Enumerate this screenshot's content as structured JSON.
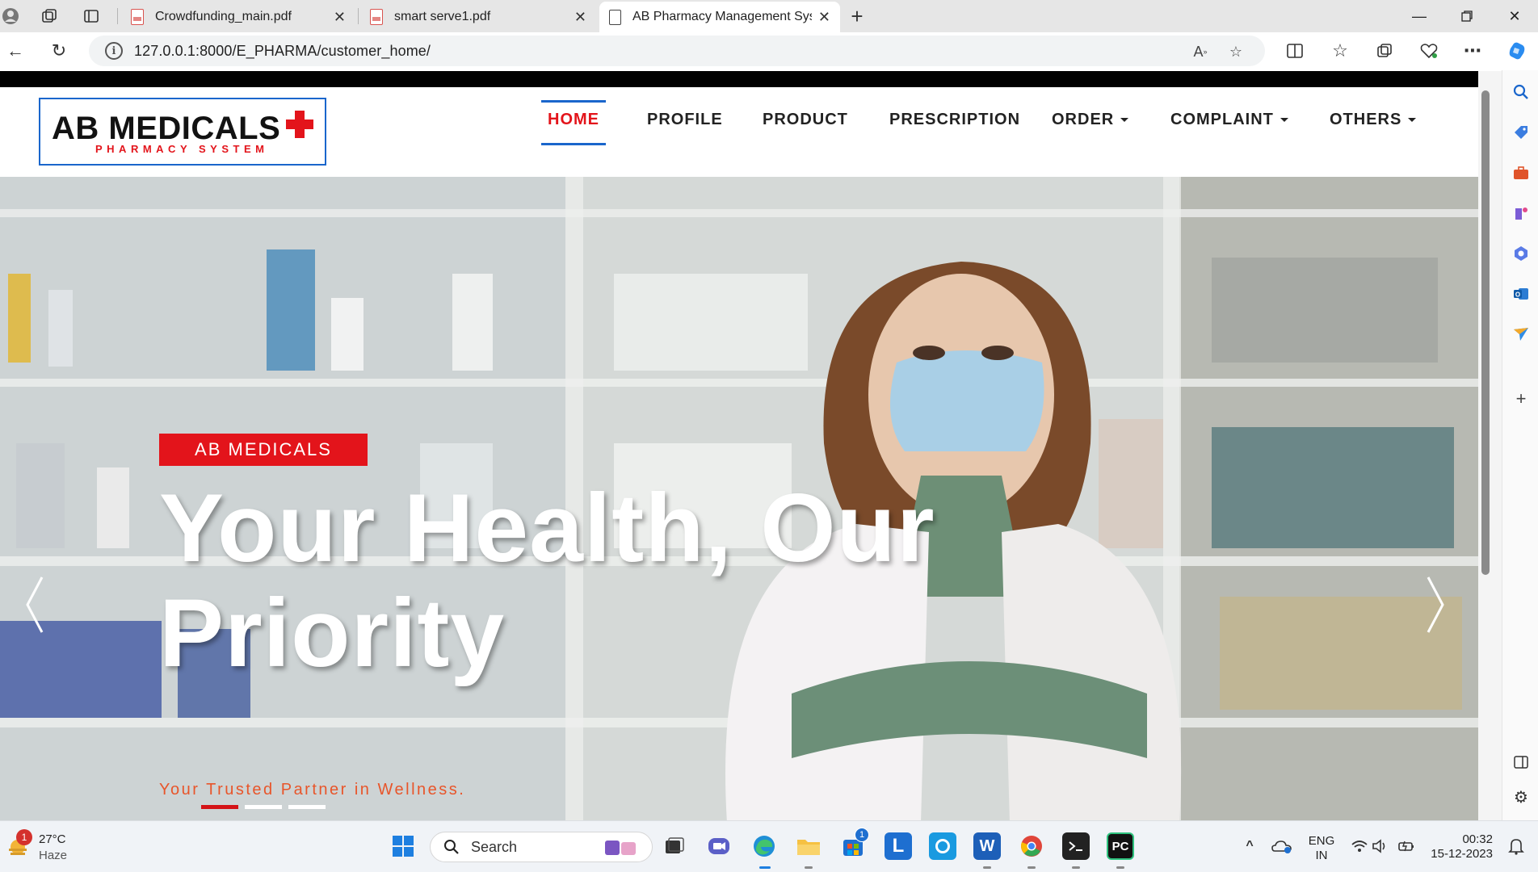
{
  "browser": {
    "tabs": [
      {
        "title": "Crowdfunding_main.pdf",
        "icon": "pdf-icon"
      },
      {
        "title": "smart serve1.pdf",
        "icon": "pdf-icon"
      },
      {
        "title": "AB Pharmacy Management Syste",
        "icon": "document-icon"
      }
    ],
    "new_tab": "+",
    "url": "127.0.0.1:8000/E_PHARMA/customer_home/"
  },
  "site": {
    "logo_main": "AB MEDICALS",
    "logo_sub": "PHARMACY SYSTEM",
    "nav": [
      {
        "label": "HOME",
        "active": true
      },
      {
        "label": "PROFILE"
      },
      {
        "label": "PRODUCT"
      },
      {
        "label": "PRESCRIPTION"
      },
      {
        "label": "ORDER",
        "dropdown": true
      },
      {
        "label": "COMPLAINT",
        "dropdown": true
      },
      {
        "label": "OTHERS",
        "dropdown": true
      }
    ]
  },
  "hero": {
    "tag": "AB MEDICALS",
    "headline_line1": "Your Health, Our",
    "headline_line2": "Priority",
    "subtitle": "Your Trusted Partner in Wellness.",
    "slide_count": 3,
    "active_slide": 1
  },
  "taskbar": {
    "weather_temp": "27°C",
    "weather_desc": "Haze",
    "weather_badge": "1",
    "search_label": "Search",
    "store_badge": "1",
    "lang_line1": "ENG",
    "lang_line2": "IN",
    "time": "00:32",
    "date": "15-12-2023"
  },
  "colors": {
    "brand_red": "#e3141b",
    "brand_blue": "#1a66cc",
    "subtitle_orange": "#e8552a"
  }
}
